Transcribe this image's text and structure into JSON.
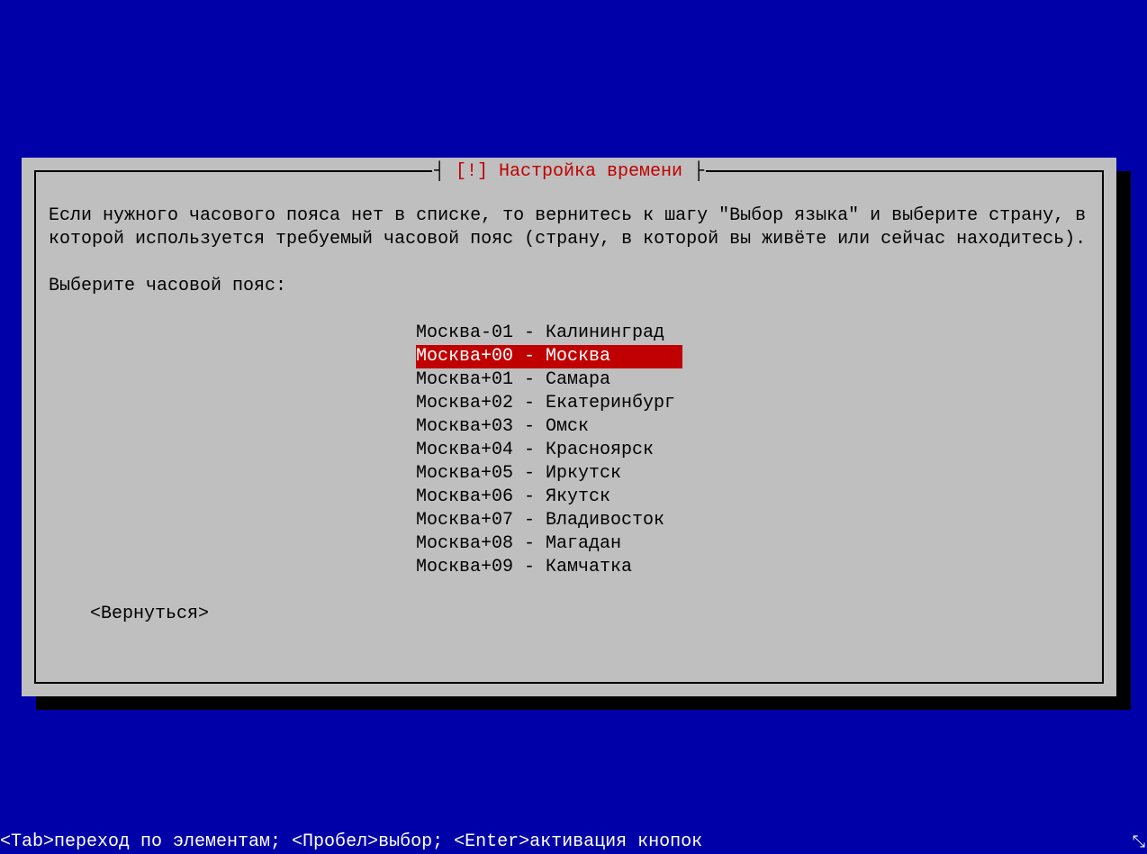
{
  "dialog": {
    "title": "[!] Настройка времени",
    "instruction": "Если нужного часового пояса нет в списке, то вернитесь к шагу \"Выбор языка\" и выберите страну, в которой используется требуемый часовой пояс (страну, в которой вы живёте или сейчас находитесь).",
    "prompt": "Выберите часовой пояс:",
    "options": [
      "Москва-01 - Калининград",
      "Москва+00 - Москва",
      "Москва+01 - Самара",
      "Москва+02 - Екатеринбург",
      "Москва+03 - Омск",
      "Москва+04 - Красноярск",
      "Москва+05 - Иркутск",
      "Москва+06 - Якутск",
      "Москва+07 - Владивосток",
      "Москва+08 - Магадан",
      "Москва+09 - Камчатка"
    ],
    "selected_index": 1,
    "back_label": "<Вернуться>"
  },
  "statusbar": {
    "text": "<Tab>переход по элементам; <Пробел>выбор; <Enter>активация кнопок"
  }
}
